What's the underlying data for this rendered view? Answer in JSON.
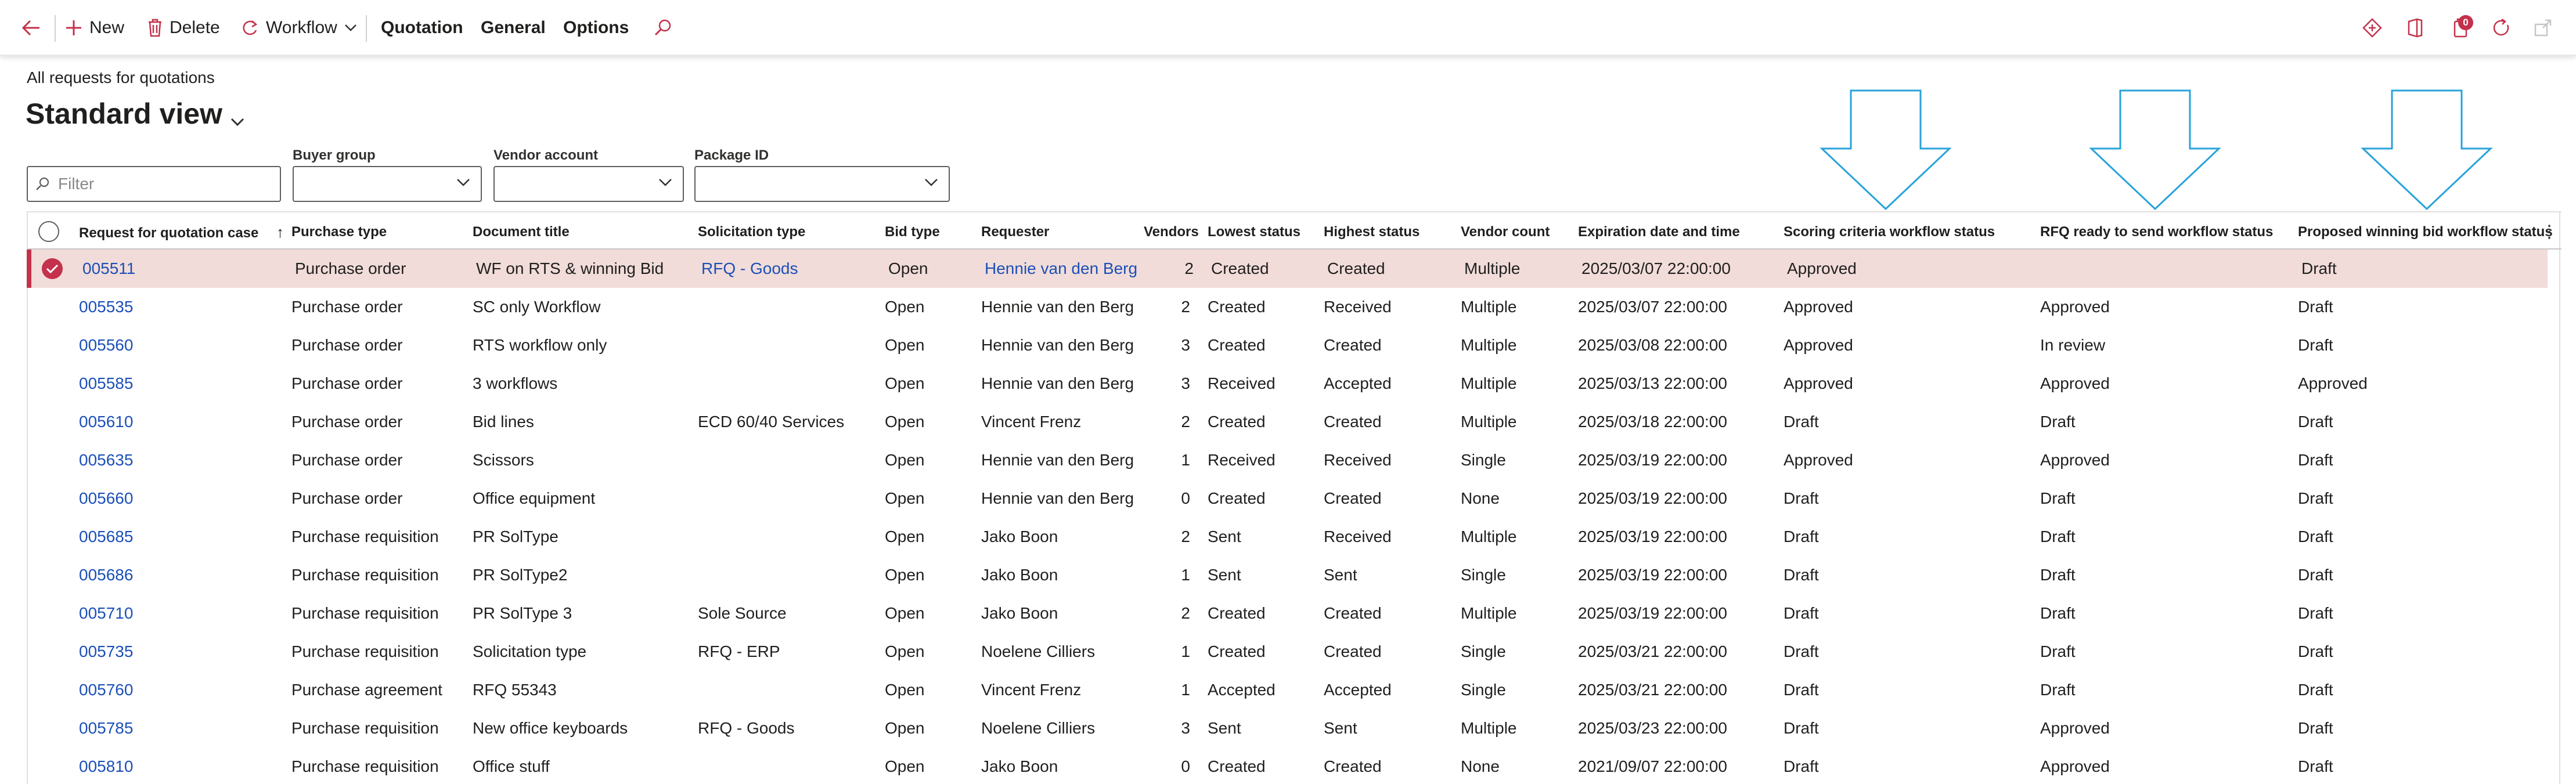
{
  "toolbar": {
    "new_label": "New",
    "delete_label": "Delete",
    "workflow_label": "Workflow",
    "tabs": [
      "Quotation",
      "General",
      "Options"
    ],
    "notification_count": "0",
    "accent_color": "#c4314b"
  },
  "page": {
    "breadcrumb": "All requests for quotations",
    "title": "Standard view"
  },
  "filters": {
    "search_placeholder": "Filter",
    "buyer_group_label": "Buyer group",
    "buyer_group_value": "",
    "vendor_account_label": "Vendor account",
    "vendor_account_value": "",
    "package_id_label": "Package ID",
    "package_id_value": ""
  },
  "grid": {
    "columns": [
      "Request for quotation case",
      "Purchase type",
      "Document title",
      "Solicitation type",
      "Bid type",
      "Requester",
      "Vendors",
      "Lowest status",
      "Highest status",
      "Vendor count",
      "Expiration date and time",
      "Scoring criteria workflow status",
      "RFQ ready to send workflow status",
      "Proposed winning bid workflow status"
    ],
    "sort_indicator": "↑",
    "rows": [
      [
        "005511",
        "Purchase order",
        "WF on RTS & winning Bid",
        "RFQ - Goods",
        "Open",
        "Hennie van den Berg",
        "2",
        "Created",
        "Created",
        "Multiple",
        "2025/03/07 22:00:00",
        "Approved",
        "",
        "Draft"
      ],
      [
        "005535",
        "Purchase order",
        "SC only Workflow",
        "",
        "Open",
        "Hennie van den Berg",
        "2",
        "Created",
        "Received",
        "Multiple",
        "2025/03/07 22:00:00",
        "Approved",
        "Approved",
        "Draft"
      ],
      [
        "005560",
        "Purchase order",
        "RTS workflow only",
        "",
        "Open",
        "Hennie van den Berg",
        "3",
        "Created",
        "Created",
        "Multiple",
        "2025/03/08 22:00:00",
        "Approved",
        "In review",
        "Draft"
      ],
      [
        "005585",
        "Purchase order",
        "3 workflows",
        "",
        "Open",
        "Hennie van den Berg",
        "3",
        "Received",
        "Accepted",
        "Multiple",
        "2025/03/13 22:00:00",
        "Approved",
        "Approved",
        "Approved"
      ],
      [
        "005610",
        "Purchase order",
        "Bid lines",
        "ECD 60/40 Services",
        "Open",
        "Vincent Frenz",
        "2",
        "Created",
        "Created",
        "Multiple",
        "2025/03/18 22:00:00",
        "Draft",
        "Draft",
        "Draft"
      ],
      [
        "005635",
        "Purchase order",
        "Scissors",
        "",
        "Open",
        "Hennie van den Berg",
        "1",
        "Received",
        "Received",
        "Single",
        "2025/03/19 22:00:00",
        "Approved",
        "Approved",
        "Draft"
      ],
      [
        "005660",
        "Purchase order",
        "Office equipment",
        "",
        "Open",
        "Hennie van den Berg",
        "0",
        "Created",
        "Created",
        "None",
        "2025/03/19 22:00:00",
        "Draft",
        "Draft",
        "Draft"
      ],
      [
        "005685",
        "Purchase requisition",
        "PR SolType",
        "",
        "Open",
        "Jako Boon",
        "2",
        "Sent",
        "Received",
        "Multiple",
        "2025/03/19 22:00:00",
        "Draft",
        "Draft",
        "Draft"
      ],
      [
        "005686",
        "Purchase requisition",
        "PR SolType2",
        "",
        "Open",
        "Jako Boon",
        "1",
        "Sent",
        "Sent",
        "Single",
        "2025/03/19 22:00:00",
        "Draft",
        "Draft",
        "Draft"
      ],
      [
        "005710",
        "Purchase requisition",
        "PR SolType 3",
        "Sole Source",
        "Open",
        "Jako Boon",
        "2",
        "Created",
        "Created",
        "Multiple",
        "2025/03/19 22:00:00",
        "Draft",
        "Draft",
        "Draft"
      ],
      [
        "005735",
        "Purchase requisition",
        "Solicitation type",
        "RFQ - ERP",
        "Open",
        "Noelene Cilliers",
        "1",
        "Created",
        "Created",
        "Single",
        "2025/03/21 22:00:00",
        "Draft",
        "Draft",
        "Draft"
      ],
      [
        "005760",
        "Purchase agreement",
        "RFQ 55343",
        "",
        "Open",
        "Vincent Frenz",
        "1",
        "Accepted",
        "Accepted",
        "Single",
        "2025/03/21 22:00:00",
        "Draft",
        "Draft",
        "Draft"
      ],
      [
        "005785",
        "Purchase requisition",
        "New office keyboards",
        "RFQ - Goods",
        "Open",
        "Noelene Cilliers",
        "3",
        "Sent",
        "Sent",
        "Multiple",
        "2025/03/23 22:00:00",
        "Draft",
        "Approved",
        "Draft"
      ],
      [
        "005810",
        "Purchase requisition",
        "Office stuff",
        "",
        "Open",
        "Jako Boon",
        "0",
        "Created",
        "Created",
        "None",
        "2021/09/07 22:00:00",
        "Draft",
        "Approved",
        "Draft"
      ]
    ]
  }
}
